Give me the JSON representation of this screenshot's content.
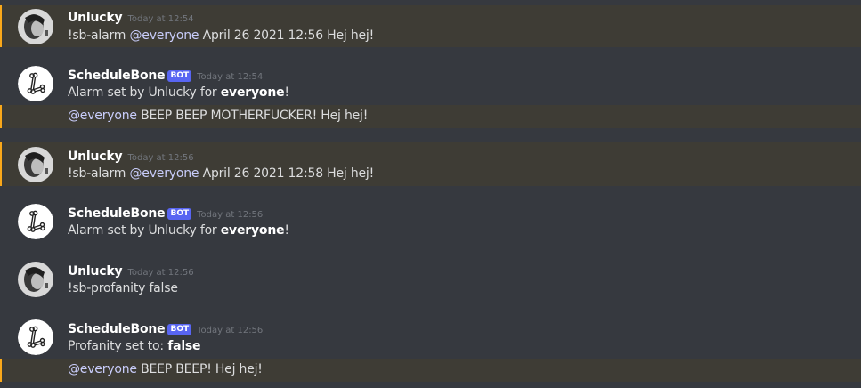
{
  "messages": [
    {
      "author": "Unlucky",
      "bot": false,
      "timestamp": "Today at 12:54",
      "lines": [
        {
          "mention": "@everyone",
          "pre": "!sb-alarm ",
          "post": " April 26 2021 12:56 Hej hej!"
        }
      ]
    },
    {
      "author": "ScheduleBone",
      "bot": true,
      "bot_tag": "BOT",
      "timestamp": "Today at 12:54",
      "line1": {
        "pre": "Alarm set by Unlucky for ",
        "bold": "everyone",
        "post": "!"
      },
      "line2": {
        "mention": "@everyone",
        "post": " BEEP BEEP MOTHERFUCKER! Hej hej!"
      }
    },
    {
      "author": "Unlucky",
      "bot": false,
      "timestamp": "Today at 12:56",
      "lines": [
        {
          "pre": "!sb-alarm ",
          "mention": "@everyone",
          "post": " April 26 2021 12:58 Hej hej!"
        }
      ]
    },
    {
      "author": "ScheduleBone",
      "bot": true,
      "bot_tag": "BOT",
      "timestamp": "Today at 12:56",
      "line1": {
        "pre": "Alarm set by Unlucky for ",
        "bold": "everyone",
        "post": "!"
      }
    },
    {
      "author": "Unlucky",
      "bot": false,
      "timestamp": "Today at 12:56",
      "text": "!sb-profanity false"
    },
    {
      "author": "ScheduleBone",
      "bot": true,
      "bot_tag": "BOT",
      "timestamp": "Today at 12:56",
      "line1": {
        "pre": "Profanity set to: ",
        "bold": "false"
      },
      "line2": {
        "mention": "@everyone",
        "post": " BEEP BEEP! Hej hej!"
      }
    }
  ],
  "colors": {
    "background": "#36393f",
    "mention_highlight_bg": "#3e3c35",
    "mention_highlight_bar": "#faa81a",
    "mention_text": "#c9cdfb",
    "bot_tag_bg": "#5865f2"
  },
  "icons": {
    "user_avatar": "user-photo-avatar-icon",
    "bot_avatar": "bone-avatar-icon"
  }
}
